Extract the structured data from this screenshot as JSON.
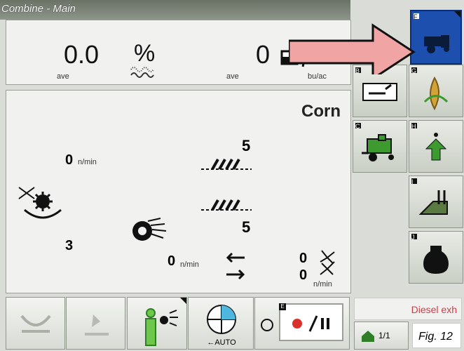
{
  "header": {
    "title": "Combine - Main"
  },
  "top_panel": {
    "moisture_value": "0.0",
    "moisture_unit": "%",
    "moisture_sub": "ave",
    "yield_value": "0",
    "yield_sub": "ave",
    "yield_unit": "bu/ac"
  },
  "main_panel": {
    "crop_name": "Corn",
    "left_speed_value": "0",
    "left_speed_unit": "n/min",
    "left_count": "3",
    "upper_value": "5",
    "lower_value": "5",
    "fan_speed_value": "0",
    "fan_speed_unit": "n/min",
    "right_top_value": "0",
    "right_bottom_value": "0",
    "right_unit": "n/min"
  },
  "right_softkeys": {
    "f_label": "F",
    "b_label": "B",
    "g_label": "G",
    "c_label": "C",
    "h_label": "H",
    "i_label": "I",
    "j_label": "J"
  },
  "bottom_bar": {
    "auto_label": "AUTO",
    "e_label": "E",
    "diesel_label": "Diesel exh",
    "page_label": "1/1",
    "fig_label": "Fig. 12"
  },
  "colors": {
    "accent_blue": "#1d4fae",
    "arrow_fill": "#f0a4a4",
    "green": "#3c9a2f",
    "red_dot": "#d8312b",
    "diesel_text": "#d13b46"
  }
}
